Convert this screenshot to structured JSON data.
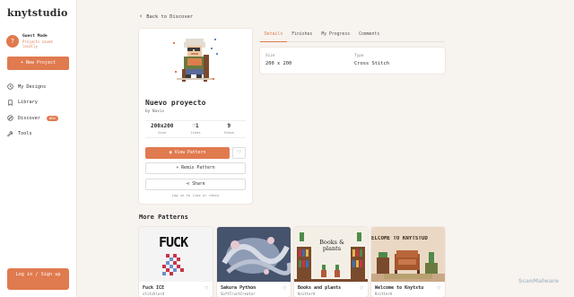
{
  "app": {
    "logo": "knytstudio"
  },
  "user": {
    "initial": "?",
    "name": "Guest Mode",
    "note": "Projects saved locally"
  },
  "sidebar": {
    "new_project": "+ New Project",
    "items": [
      {
        "label": "My Designs",
        "icon": "clock-icon"
      },
      {
        "label": "Library",
        "icon": "bookmark-icon"
      },
      {
        "label": "Discover",
        "icon": "compass-icon",
        "badge": "NEW"
      },
      {
        "label": "Tools",
        "icon": "wrench-icon"
      }
    ],
    "login": "Log in / Sign up"
  },
  "nav": {
    "back": "Back to Discover"
  },
  "project": {
    "title": "Nuevo proyecto",
    "by": "by Noxis",
    "stats": [
      {
        "value": "200x200",
        "label": "Size"
      },
      {
        "value": "1",
        "label": "likes"
      },
      {
        "value": "9",
        "label": "Views"
      }
    ],
    "view_label": "View Pattern",
    "remix_label": "Remix Pattern",
    "share_label": "Share",
    "note": "Log in to like or remix"
  },
  "tabs": [
    "Details",
    "Finishes",
    "My Progress",
    "Comments"
  ],
  "details": [
    {
      "label": "Size",
      "value": "200 x 200"
    },
    {
      "label": "Type",
      "value": "Cross Stitch"
    }
  ],
  "more": {
    "title": "More Patterns",
    "items": [
      {
        "title": "Fuck ICE",
        "author": "stitchlord",
        "image_text": "FUCK"
      },
      {
        "title": "Sakura Python",
        "author": "SoftTrustCreator"
      },
      {
        "title": "Books and plants",
        "author": "KnitterA",
        "image_text": "Books & plants"
      },
      {
        "title": "Welcome to Knytstu",
        "author": "KnitterA",
        "image_text": "ELCOME TO KNYTSTUD"
      }
    ]
  },
  "watermark": "ScanMalware",
  "colors": {
    "accent": "#e07a4f",
    "background": "#f7f3ef"
  }
}
